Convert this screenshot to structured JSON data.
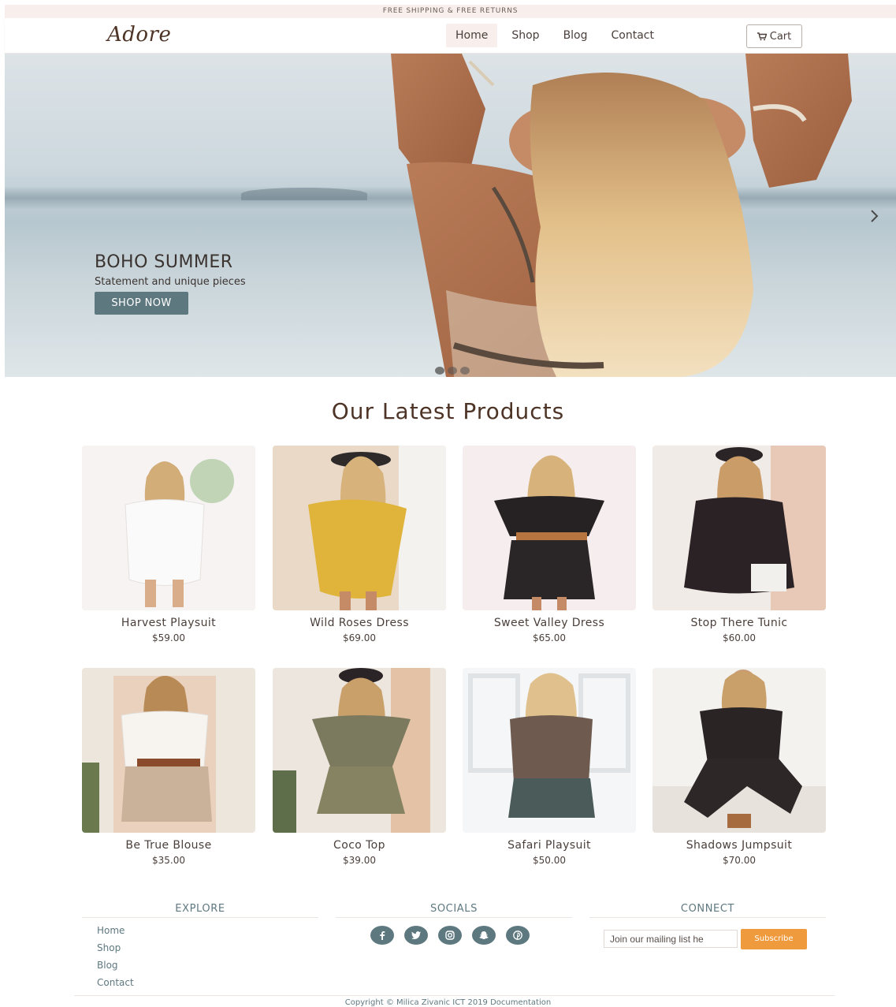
{
  "topbar": {
    "text": "FREE SHIPPING & FREE RETURNS"
  },
  "header": {
    "logo": "Adore",
    "nav": [
      {
        "label": "Home",
        "active": true
      },
      {
        "label": "Shop",
        "active": false
      },
      {
        "label": "Blog",
        "active": false
      },
      {
        "label": "Contact",
        "active": false
      }
    ],
    "cart_label": "Cart",
    "cart_icon": "shopping-cart-icon"
  },
  "hero": {
    "title": "BOHO SUMMER",
    "subtitle": "Statement and unique pieces",
    "cta": "SHOP NOW",
    "next_icon": "chevron-right-icon",
    "slides": 3,
    "active_slide": 1
  },
  "products": {
    "title": "Our Latest Products",
    "items": [
      {
        "name": "Harvest Playsuit",
        "price": "$59.00",
        "color": "#f2eeee"
      },
      {
        "name": "Wild Roses Dress",
        "price": "$69.00",
        "color": "#d9b44a"
      },
      {
        "name": "Sweet Valley Dress",
        "price": "$65.00",
        "color": "#2a2526"
      },
      {
        "name": "Stop There Tunic",
        "price": "$60.00",
        "color": "#2b2226"
      },
      {
        "name": "Be True Blouse",
        "price": "$35.00",
        "color": "#f0ece6"
      },
      {
        "name": "Coco Top",
        "price": "$39.00",
        "color": "#7b7a5e"
      },
      {
        "name": "Safari Playsuit",
        "price": "$50.00",
        "color": "#6e5a4e"
      },
      {
        "name": "Shadows Jumpsuit",
        "price": "$70.00",
        "color": "#2a2425"
      }
    ]
  },
  "footer": {
    "explore_title": "EXPLORE",
    "explore_links": [
      "Home",
      "Shop",
      "Blog",
      "Contact"
    ],
    "socials_title": "SOCIALS",
    "socials": [
      "facebook-icon",
      "twitter-icon",
      "instagram-icon",
      "snapchat-icon",
      "pinterest-icon"
    ],
    "connect_title": "CONNECT",
    "mail_placeholder": "Join our mailing list he",
    "subscribe_label": "Subscribe",
    "copyright": "Copyright © Milica Zivanic ICT 2019",
    "doc_link": "Documentation"
  },
  "colors": {
    "accent": "#5e7880",
    "subscribe": "#ef9b3d",
    "brand": "#4d3426",
    "topbar": "#f8efec"
  }
}
